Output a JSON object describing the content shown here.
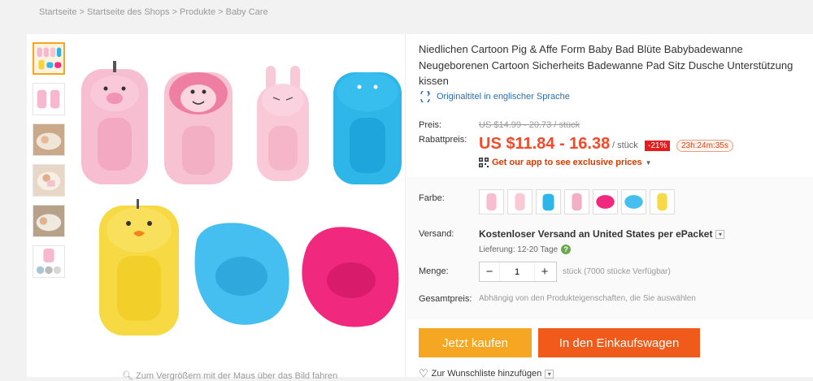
{
  "breadcrumb": "Startseite > Startseite des Shops > Produkte > Baby Care",
  "product": {
    "title": "Niedlichen Cartoon Pig & Affe Form Baby Bad Blüte Babybadewanne Neugeborenen Cartoon Sicherheits Badewanne Pad Sitz Dusche Unterstützung kissen",
    "original_title_link": "Originaltitel in englischer Sprache"
  },
  "price": {
    "label_price": "Preis:",
    "label_discount": "Rabattpreis:",
    "old": "US $14.99 - 20.73 / stück",
    "current": "US $11.84 - 16.38",
    "per": "/ stück",
    "discount_badge": "-21%",
    "timer": "23h:24m:35s",
    "app_promo": "Get our app to see exclusive prices"
  },
  "options": {
    "color_label": "Farbe:",
    "shipping_label": "Versand:",
    "shipping_text": "Kostenloser Versand an United States per ePacket",
    "delivery_text": "Lieferung: 12-20 Tage",
    "quantity_label": "Menge:",
    "quantity_value": "1",
    "stock_text": "stück (7000 stücke Verfügbar)",
    "total_label": "Gesamtpreis:",
    "total_text": "Abhängig von den Produkteigenschaften, die Sie auswählen"
  },
  "actions": {
    "buy_now": "Jetzt kaufen",
    "add_to_cart": "In den Einkaufswagen",
    "wishlist": "Zur Wunschliste hinzufügen"
  },
  "gallery": {
    "zoom_hint": "Zum Vergrößern mit der Maus über das Bild fahren"
  },
  "colors": {
    "price_red": "#f5492a",
    "buy_orange": "#f5a623",
    "cart_orange": "#f05a1a",
    "link_blue": "#2d6fb0"
  }
}
